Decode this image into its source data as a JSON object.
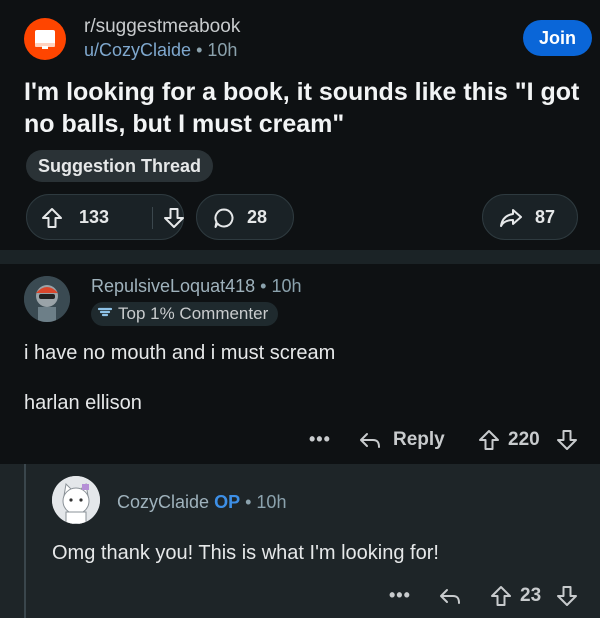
{
  "post": {
    "subreddit": "r/suggestmeabook",
    "author": "u/CozyClaide",
    "separator": "•",
    "age": "10h",
    "join_label": "Join",
    "title": "I'm looking for a book, it sounds like this \"I got no balls, but I must cream\"",
    "flair": "Suggestion Thread",
    "upvotes": "133",
    "comments": "28",
    "shares": "87"
  },
  "comments": [
    {
      "author": "RepulsiveLoquat418",
      "separator": "•",
      "age": "10h",
      "badge": "Top 1% Commenter",
      "lines": [
        "i have no mouth and i must scream",
        "harlan ellison"
      ],
      "more": "•••",
      "reply_label": "Reply",
      "votes": "220"
    },
    {
      "author": "CozyClaide",
      "op_tag": "OP",
      "separator": "•",
      "age": "10h",
      "text": "Omg thank you! This is what I'm looking for!",
      "more": "•••",
      "votes": "23"
    }
  ],
  "colors": {
    "join_button": "#0a66d8",
    "subreddit_icon": "#ff4500",
    "op_tag": "#3d8fe6",
    "background": "#0e1113"
  },
  "icons": [
    "subreddit-icon",
    "upvote-icon",
    "downvote-icon",
    "comment-icon",
    "share-icon",
    "reply-icon",
    "more-icon",
    "comment-bubble-icon"
  ]
}
